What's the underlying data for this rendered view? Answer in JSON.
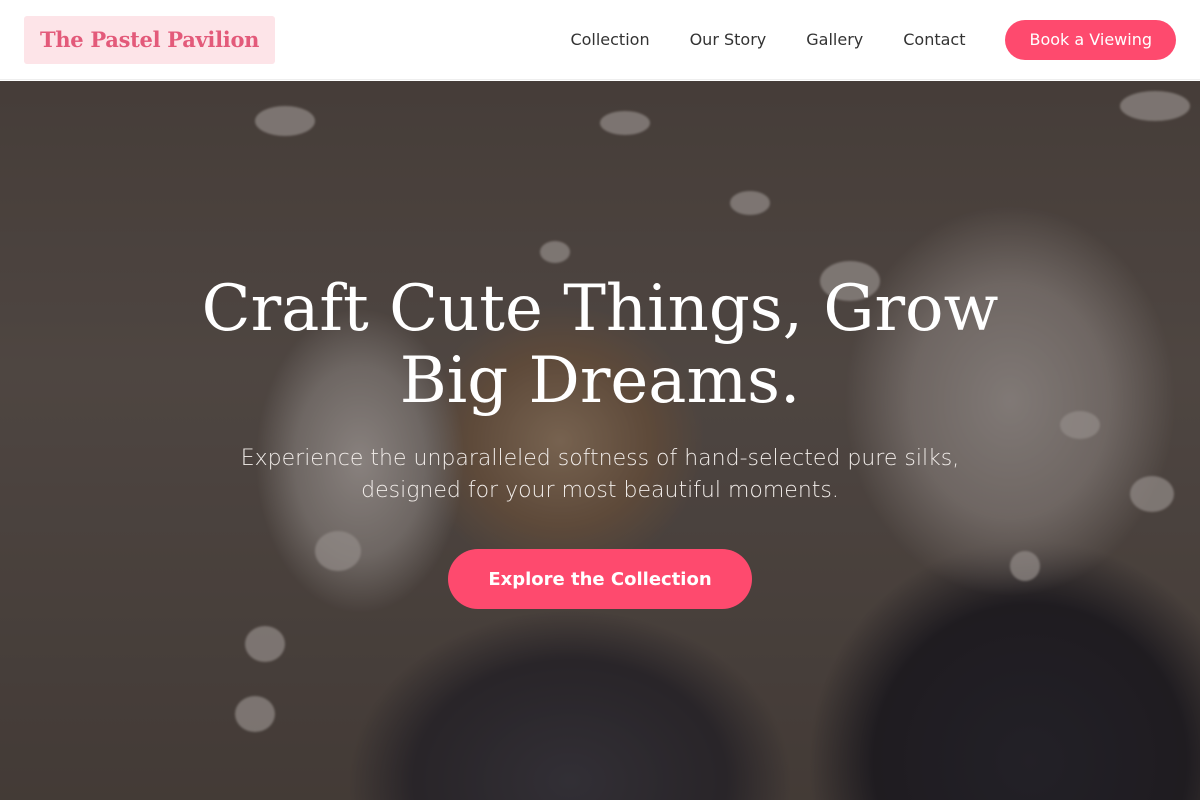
{
  "brand": {
    "name": "The Pastel Pavilion"
  },
  "nav": {
    "links": [
      "Collection",
      "Our Story",
      "Gallery",
      "Contact"
    ],
    "cta_label": "Book a Viewing"
  },
  "hero": {
    "title": "Craft Cute Things, Grow Big Dreams.",
    "subtitle": "Experience the unparalleled softness of hand-selected pure silks, designed for your most beautiful moments.",
    "cta_label": "Explore the Collection"
  },
  "colors": {
    "accent": "#fe4a6e",
    "logo_bg": "#fde4e8",
    "logo_text": "#e35a7a"
  }
}
